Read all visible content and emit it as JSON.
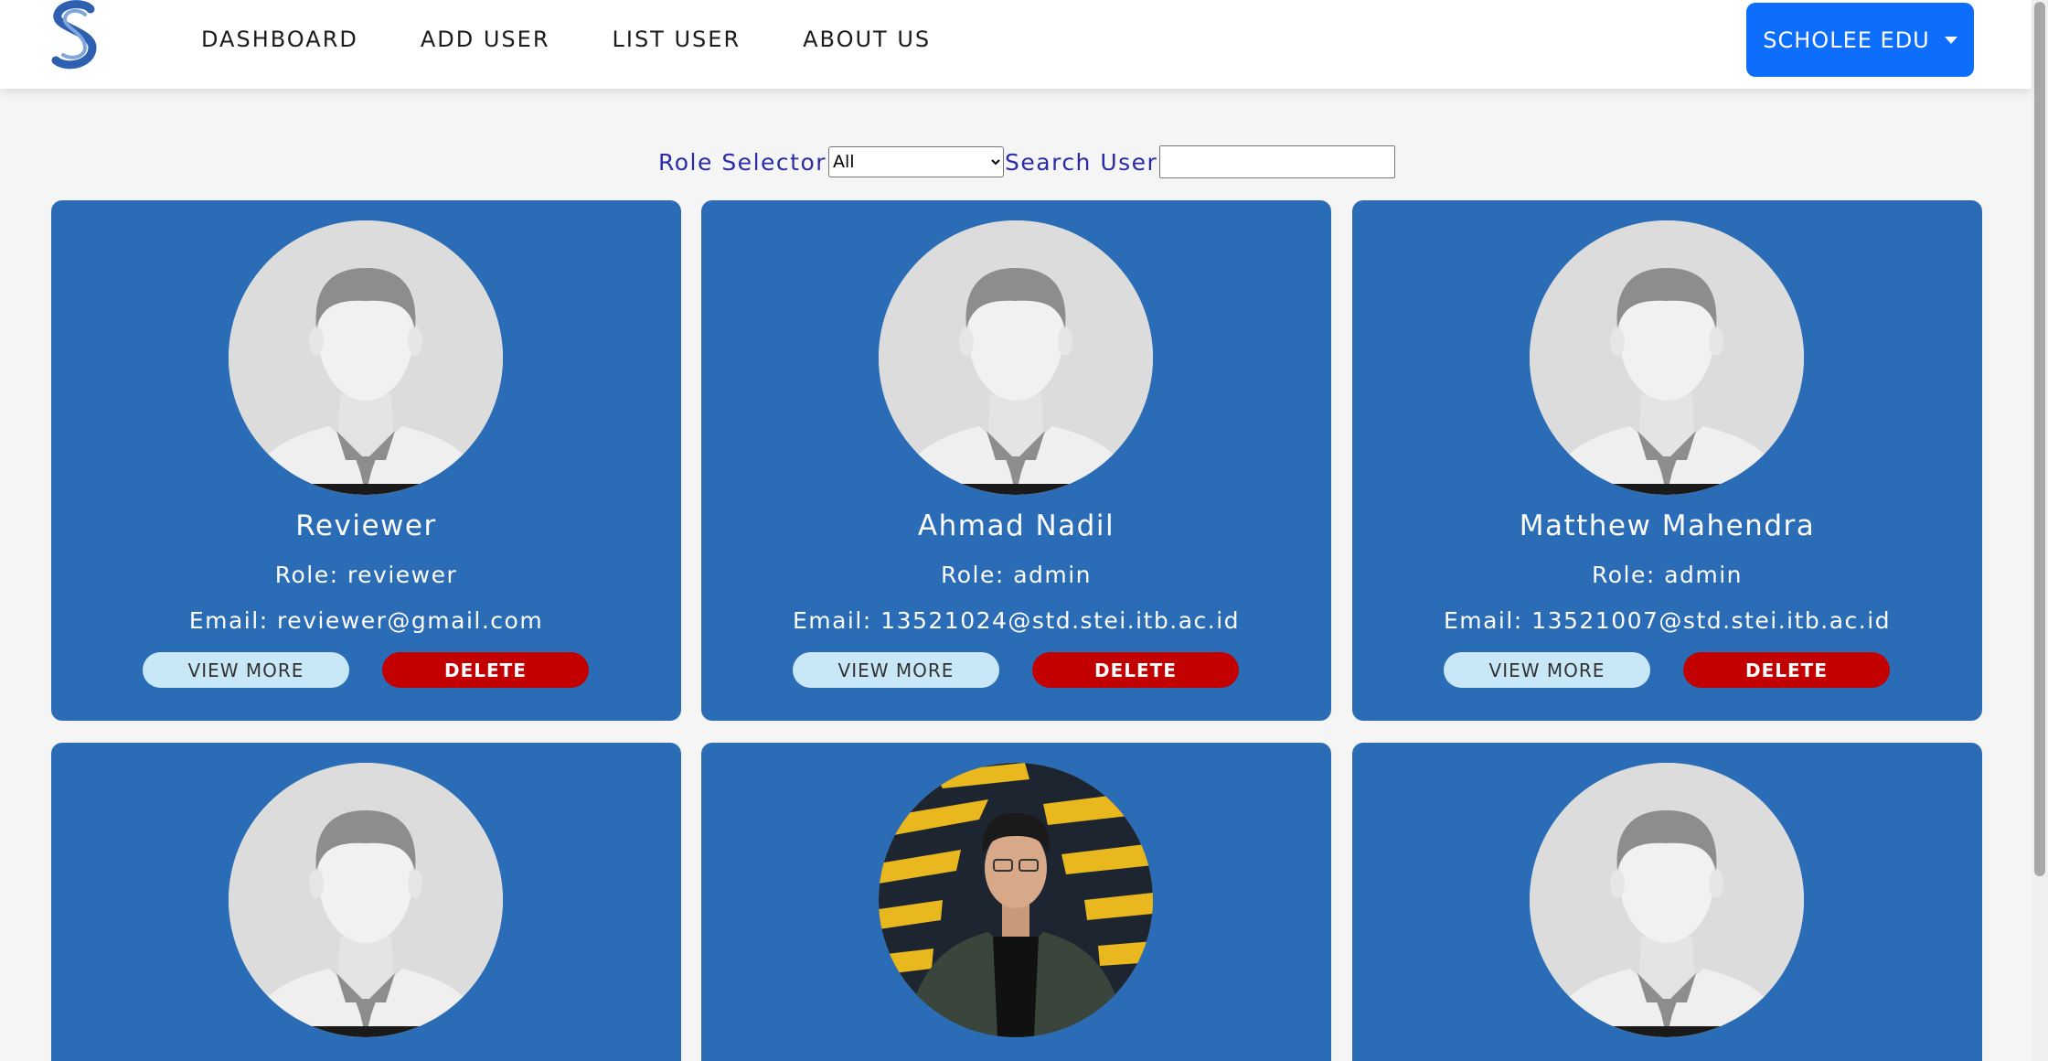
{
  "nav": {
    "links": [
      "DASHBOARD",
      "ADD USER",
      "LIST USER",
      "ABOUT US"
    ],
    "brand_dropdown": "SCHOLEE EDU"
  },
  "filters": {
    "role_label": "Role Selector",
    "role_selected": "All",
    "search_label": "Search User",
    "search_value": ""
  },
  "buttons": {
    "view_more": "VIEW MORE",
    "delete": "DELETE"
  },
  "users": [
    {
      "name": "Reviewer",
      "role": "Role: reviewer",
      "email": "Email: reviewer@gmail.com",
      "avatar": "default-avatar"
    },
    {
      "name": "Ahmad Nadil",
      "role": "Role: admin",
      "email": "Email: 13521024@std.stei.itb.ac.id",
      "avatar": "default-avatar"
    },
    {
      "name": "Matthew Mahendra",
      "role": "Role: admin",
      "email": "Email: 13521007@std.stei.itb.ac.id",
      "avatar": "default-avatar"
    },
    {
      "name": "",
      "role": "",
      "email": "",
      "avatar": "default-avatar"
    },
    {
      "name": "",
      "role": "",
      "email": "",
      "avatar": "profile-photo"
    },
    {
      "name": "",
      "role": "",
      "email": "",
      "avatar": "default-avatar"
    }
  ],
  "colors": {
    "card_bg": "#2b6cb7",
    "nav_brand": "#0d6efd",
    "delete": "#c20000",
    "view_more": "#c8e8f8",
    "filter_label": "#2b2ba8"
  }
}
